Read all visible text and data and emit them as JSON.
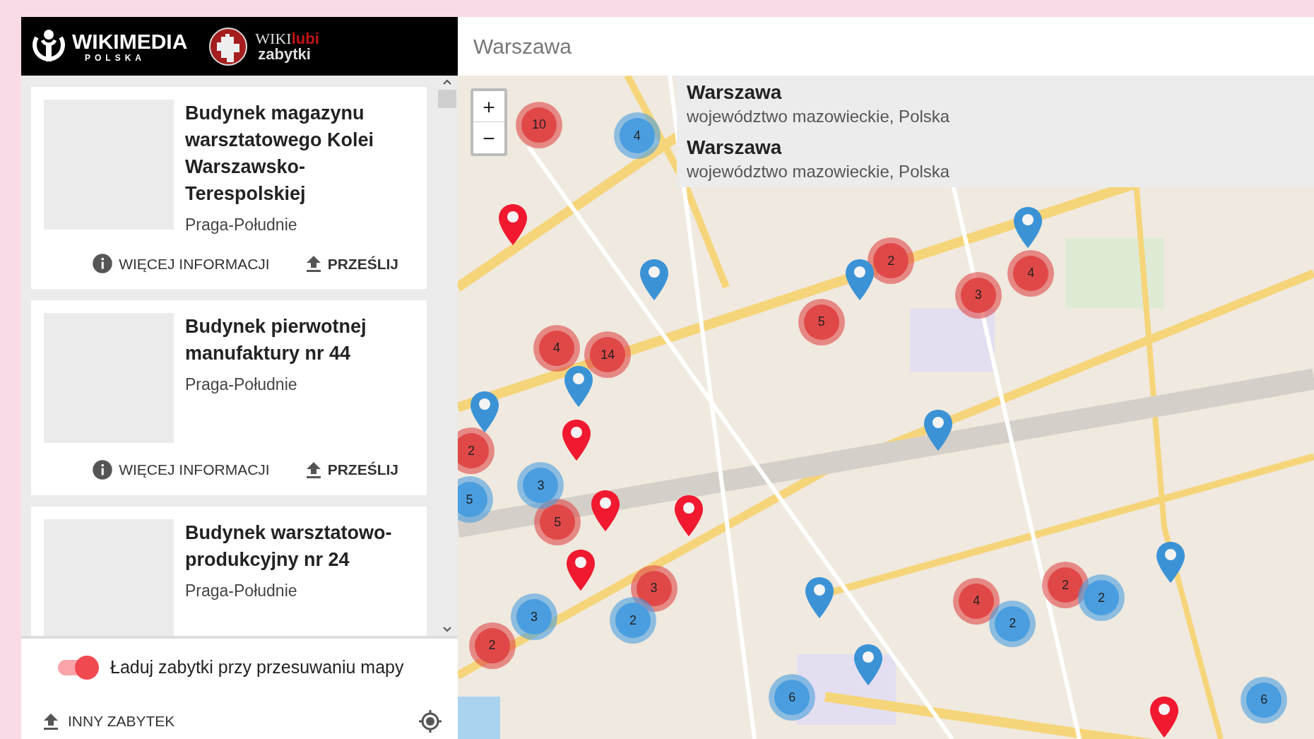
{
  "header": {
    "logo_text": "WIKIMEDIA",
    "logo_subtext": "POLSKA",
    "partner_logo": {
      "word_1": "WIKI",
      "word_2": "lubi",
      "word_3": "zabytki"
    }
  },
  "search": {
    "value": "Warszawa"
  },
  "suggestions": [
    {
      "name": "Warszawa",
      "region": "województwo mazowieckie, Polska"
    },
    {
      "name": "Warszawa",
      "region": "województwo mazowieckie, Polska"
    }
  ],
  "monuments": [
    {
      "title": "Budynek magazynu warsztatowego Kolei Warszawsko-Terespolskiej",
      "district": "Praga-Południe",
      "actions": [
        {
          "kind": "info",
          "label": "WIĘCEJ INFORMACJI"
        },
        {
          "kind": "upload",
          "label": "PRZEŚLIJ"
        }
      ]
    },
    {
      "title": "Budynek pierwotnej manufaktury nr 44",
      "district": "Praga-Południe",
      "actions": [
        {
          "kind": "info",
          "label": "WIĘCEJ INFORMACJI"
        },
        {
          "kind": "upload",
          "label": "PRZEŚLIJ"
        }
      ]
    },
    {
      "title": "Budynek warsztatowo-produkcyjny nr 24",
      "district": "Praga-Południe"
    }
  ],
  "map": {
    "zoom_in": "+",
    "zoom_out": "−",
    "clusters": [
      {
        "count": "10",
        "color": "#e04848"
      },
      {
        "count": "2",
        "color": "#e04848"
      },
      {
        "count": "4",
        "color": "#e04848"
      },
      {
        "count": "3",
        "color": "#e04848"
      },
      {
        "count": "5",
        "color": "#e04848"
      },
      {
        "count": "4",
        "color": "#e04848"
      },
      {
        "count": "14",
        "color": "#e04848"
      },
      {
        "count": "2",
        "color": "#e04848"
      },
      {
        "count": "5",
        "color": "#e04848"
      },
      {
        "count": "3",
        "color": "#e04848"
      },
      {
        "count": "2",
        "color": "#e04848"
      },
      {
        "count": "4",
        "color": "#e04848"
      },
      {
        "count": "2",
        "color": "#e04848"
      },
      {
        "count": "4",
        "color": "#4a9ee0"
      },
      {
        "count": "3",
        "color": "#4a9ee0"
      },
      {
        "count": "5",
        "color": "#4a9ee0"
      },
      {
        "count": "3",
        "color": "#4a9ee0"
      },
      {
        "count": "2",
        "color": "#4a9ee0"
      },
      {
        "count": "2",
        "color": "#4a9ee0"
      },
      {
        "count": "2",
        "color": "#4a9ee0"
      },
      {
        "count": "6",
        "color": "#4a9ee0"
      },
      {
        "count": "6",
        "color": "#4a9ee0"
      }
    ],
    "pins": [
      {
        "color": "#3b93d6"
      },
      {
        "color": "#3b93d6"
      },
      {
        "color": "#3b93d6"
      },
      {
        "color": "#3b93d6"
      },
      {
        "color": "#3b93d6"
      },
      {
        "color": "#3b93d6"
      },
      {
        "color": "#3b93d6"
      },
      {
        "color": "#3b93d6"
      },
      {
        "color": "#3b93d6"
      },
      {
        "color": "#f0192f"
      },
      {
        "color": "#f0192f"
      },
      {
        "color": "#f0192f"
      },
      {
        "color": "#f0192f"
      },
      {
        "color": "#f0192f"
      },
      {
        "color": "#f0192f"
      }
    ]
  },
  "auto_load": {
    "label": "Ładuj zabytki przy przesuwaniu mapy",
    "on": true
  },
  "other_monument": {
    "label": "INNY ZABYTEK"
  }
}
